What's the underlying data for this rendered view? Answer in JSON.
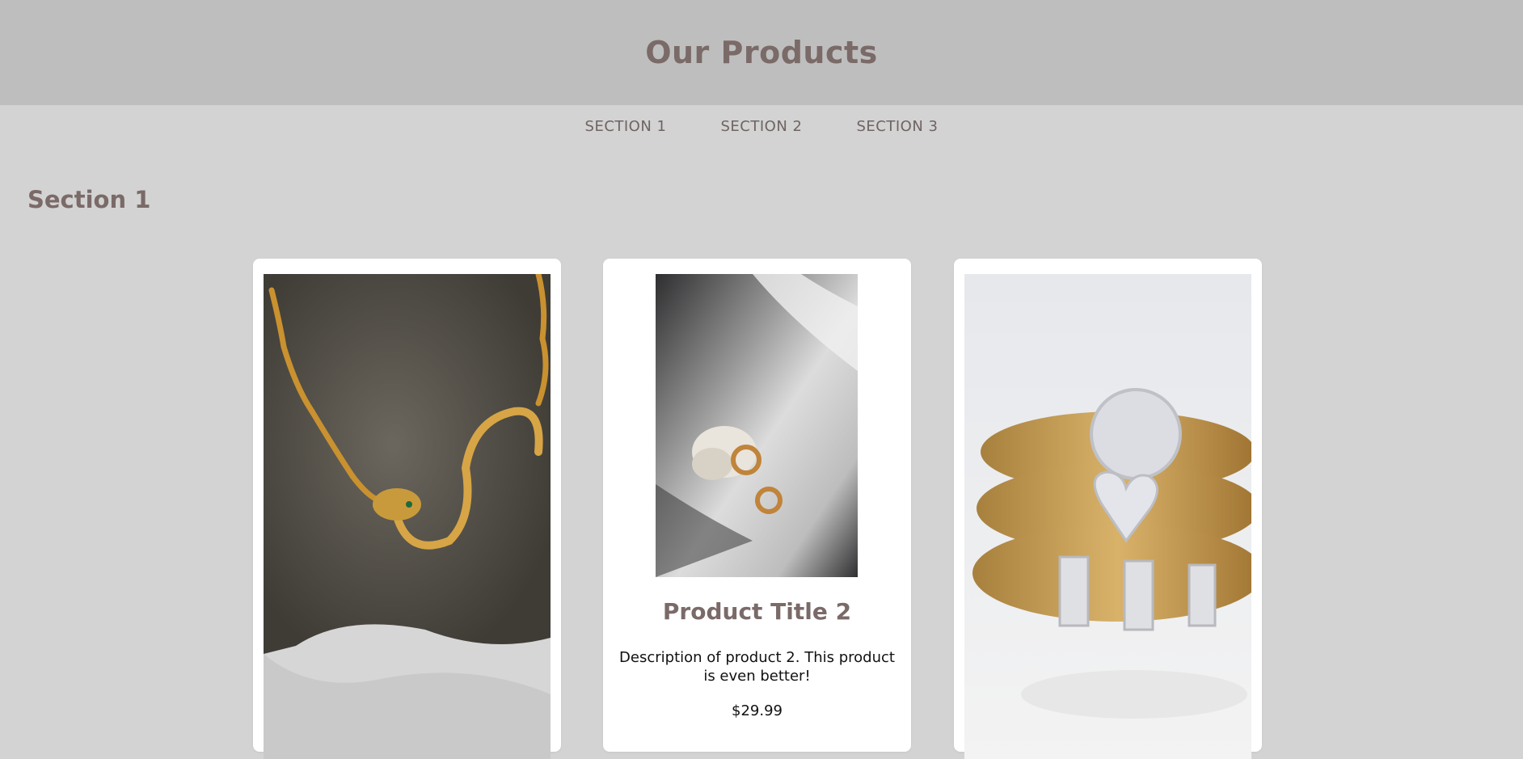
{
  "header": {
    "title": "Our Products"
  },
  "nav": {
    "items": [
      {
        "label": "SECTION 1"
      },
      {
        "label": "SECTION 2"
      },
      {
        "label": "SECTION 3"
      }
    ]
  },
  "section": {
    "heading": "Section 1",
    "products": [
      {
        "image": "gold-snake-chain-necklace-on-rock"
      },
      {
        "image": "gold-hoop-earrings-on-stone",
        "title": "Product Title 2",
        "description": "Description of product 2. This product is even better!",
        "price": "$29.99"
      },
      {
        "image": "gold-mesh-rings-with-diamonds"
      }
    ]
  },
  "colors": {
    "header_bg": "#bebebe",
    "page_bg": "#d3d3d3",
    "accent_text": "#7a6a68",
    "card_bg": "#ffffff"
  }
}
